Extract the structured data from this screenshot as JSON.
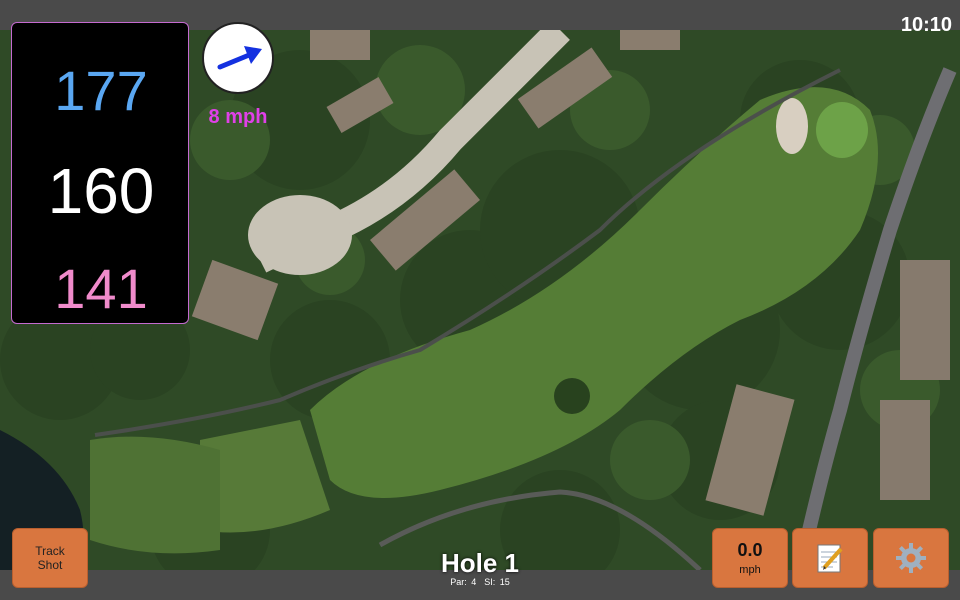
{
  "status": {
    "time": "10:10"
  },
  "distances": {
    "back": "177",
    "back_color": "#5aa7f2",
    "middle": "160",
    "middle_color": "#ffffff",
    "front": "141",
    "front_color": "#f08bcb"
  },
  "wind": {
    "speed_label": "8 mph",
    "color": "#e040e8",
    "arrow_icon": "wind-arrow-icon"
  },
  "hole": {
    "title": "Hole 1",
    "par": "Par: 4",
    "si": "SI: 15"
  },
  "buttons": {
    "track_line1": "Track",
    "track_line2": "Shot",
    "speed_value": "0.0",
    "speed_unit": "mph",
    "notes_icon": "notepad-icon",
    "settings_icon": "gear-icon",
    "accent": "#d9763f"
  }
}
